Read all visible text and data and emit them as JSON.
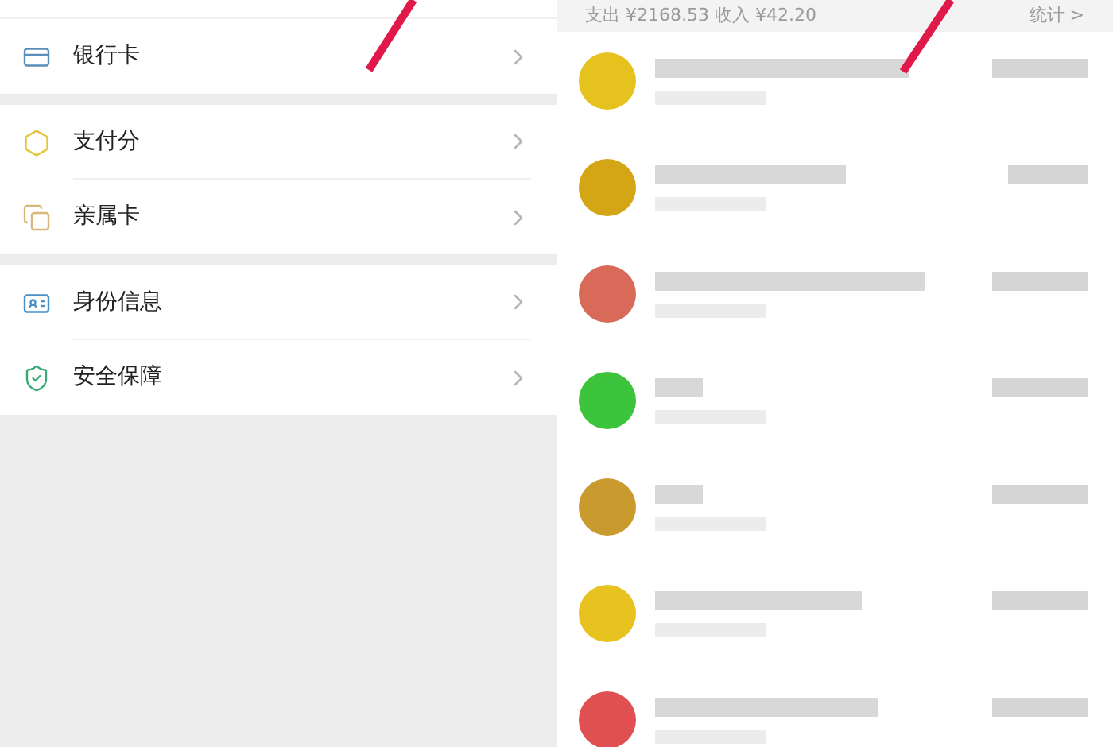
{
  "menu_groups": [
    {
      "items": [
        {
          "label": "银行卡",
          "kind": "card"
        }
      ]
    },
    {
      "items": [
        {
          "label": "支付分",
          "kind": "score"
        },
        {
          "label": "亲属卡",
          "kind": "family"
        }
      ]
    },
    {
      "items": [
        {
          "label": "身份信息",
          "kind": "identity"
        },
        {
          "label": "安全保障",
          "kind": "security"
        }
      ]
    }
  ],
  "bill": {
    "summary": "支出 ¥2168.53 收入 ¥42.20",
    "stats_link": "统计 >",
    "transactions": [
      {
        "color": "#e6c21f"
      },
      {
        "color": "#d4a514"
      },
      {
        "color": "#d96a5a"
      },
      {
        "color": "#3cc43c"
      },
      {
        "color": "#c99a2e"
      },
      {
        "color": "#e8c21f"
      },
      {
        "color": "#e05050"
      }
    ]
  }
}
